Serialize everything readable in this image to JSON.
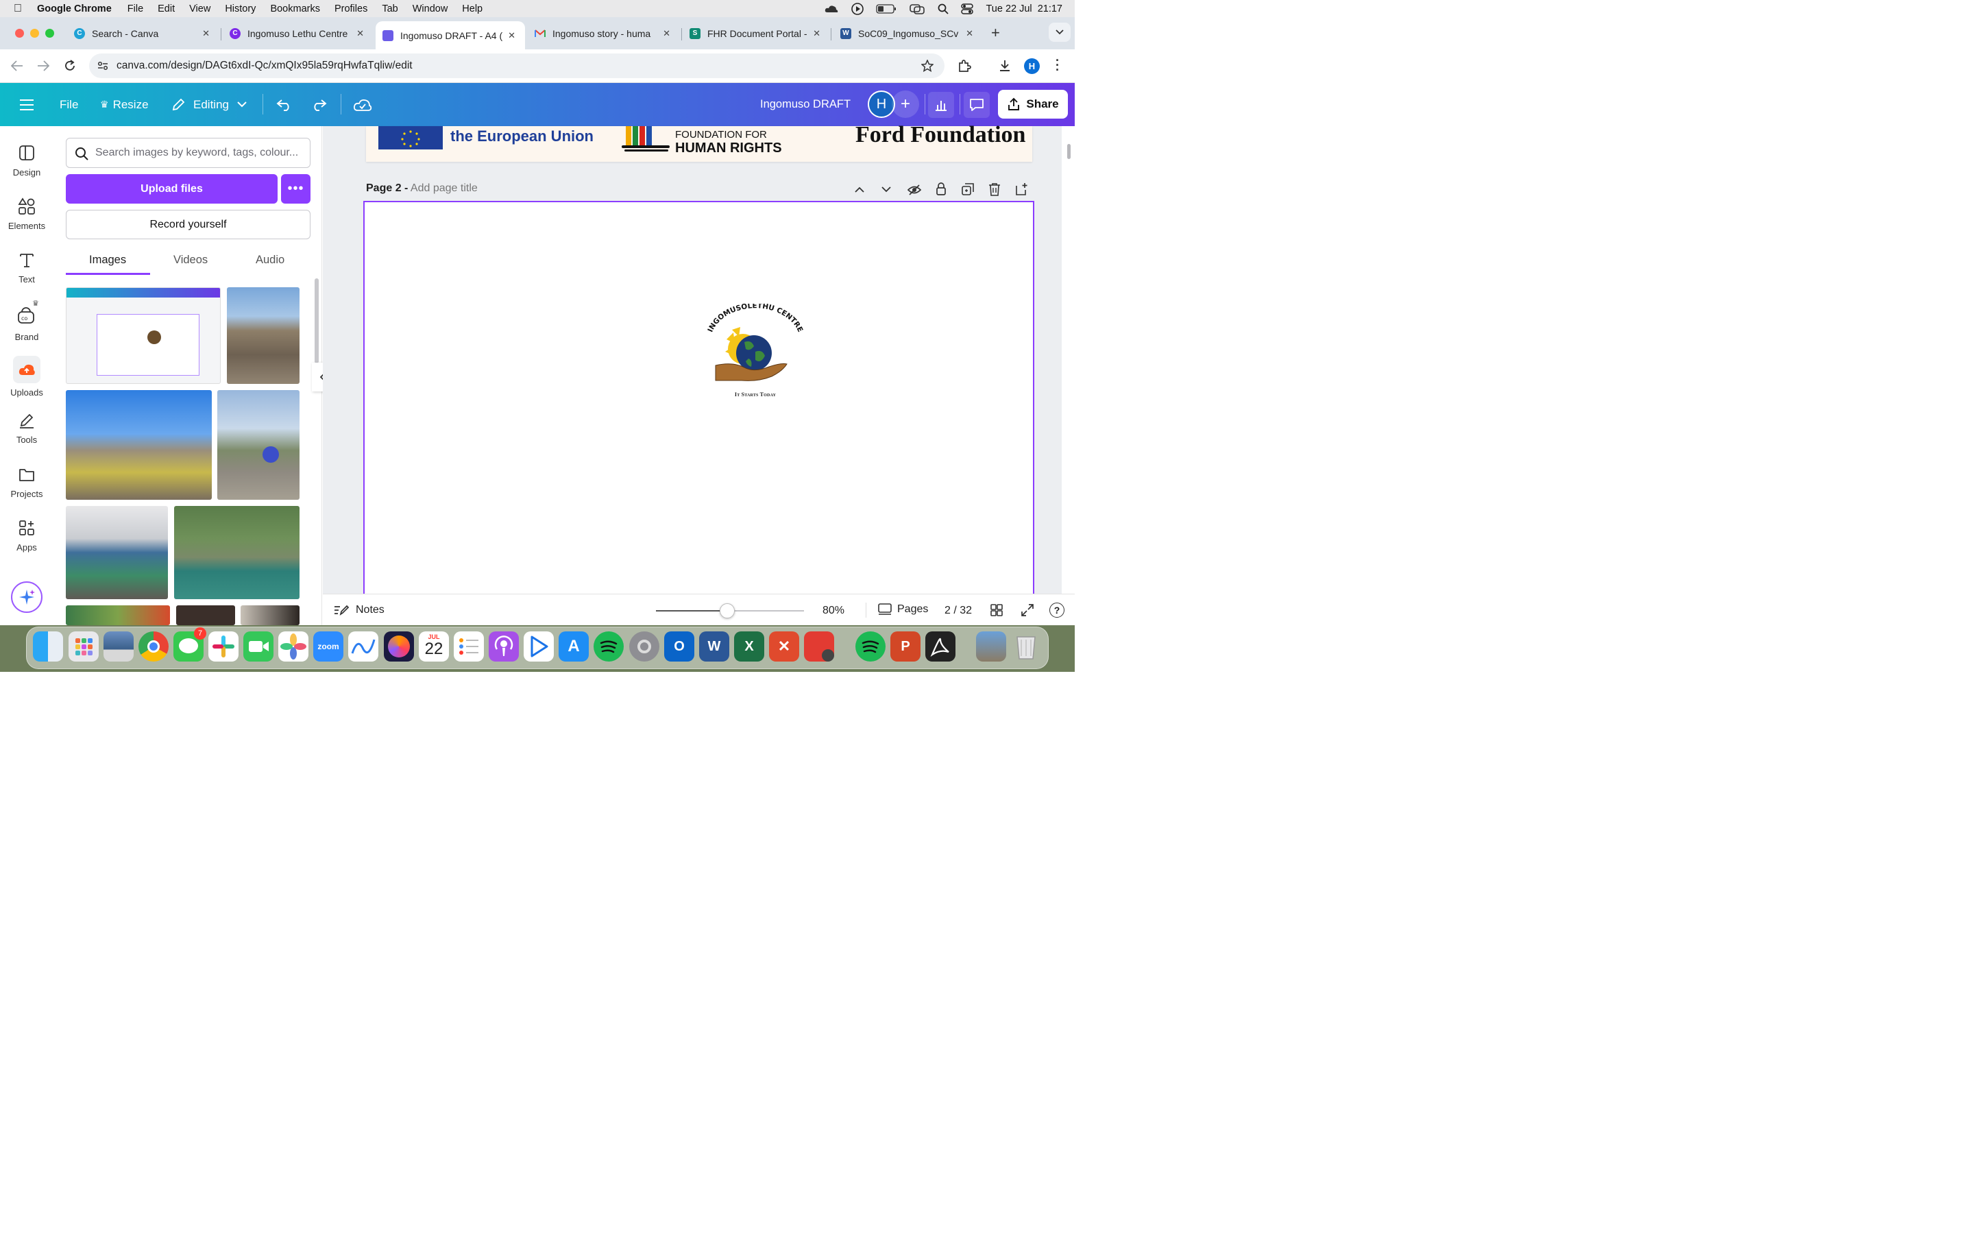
{
  "menubar": {
    "apple": "",
    "app_name": "Google Chrome",
    "items": [
      "File",
      "Edit",
      "View",
      "History",
      "Bookmarks",
      "Profiles",
      "Tab",
      "Window",
      "Help"
    ],
    "clock": "Tue 22 Jul  21:17"
  },
  "tabs": [
    {
      "title": "Search - Canva",
      "fav_color": "#1fa2d6"
    },
    {
      "title": "Ingomuso Lethu Centre",
      "fav_color": "#7d2ae8"
    },
    {
      "title": "Ingomuso DRAFT - A4 (",
      "fav_color": "#6b5ce7"
    },
    {
      "title": "Ingomuso story - huma",
      "fav_color": "#ea4335"
    },
    {
      "title": "FHR Document Portal -",
      "fav_color": "#0f8a73"
    },
    {
      "title": "SoC09_Ingomuso_SCv",
      "fav_color": "#2b5797"
    }
  ],
  "address": {
    "url": "canva.com/design/DAGt6xdI-Qc/xmQIx95la59rqHwfaTqliw/edit"
  },
  "profile_initial": "H",
  "canva": {
    "file": "File",
    "resize": "Resize",
    "editing": "Editing",
    "doc_title": "Ingomuso DRAFT",
    "avatar": "H",
    "share": "Share"
  },
  "rail": [
    "Design",
    "Elements",
    "Text",
    "Brand",
    "Uploads",
    "Tools",
    "Projects",
    "Apps"
  ],
  "panel": {
    "search_placeholder": "Search images by keyword, tags, colour...",
    "upload": "Upload files",
    "record": "Record yourself",
    "tabs": [
      "Images",
      "Videos",
      "Audio"
    ]
  },
  "page1": {
    "eu_text": "the European Union",
    "fhr_line1": "FOUNDATION FOR",
    "fhr_line2": "HUMAN RIGHTS",
    "ford": "Ford Foundation"
  },
  "page2": {
    "label": "Page 2 -",
    "title_placeholder": "Add page title",
    "logo_text": "INGOMUSOLETHU CENTRE",
    "logo_tagline": "It Starts Today"
  },
  "footer": {
    "notes": "Notes",
    "zoom": "80%",
    "pages": "Pages",
    "page_count": "2 / 32",
    "zoom_level": 0.48
  },
  "dock": {
    "calendar_month": "JUL",
    "calendar_day": "22",
    "messages_badge": "7"
  }
}
